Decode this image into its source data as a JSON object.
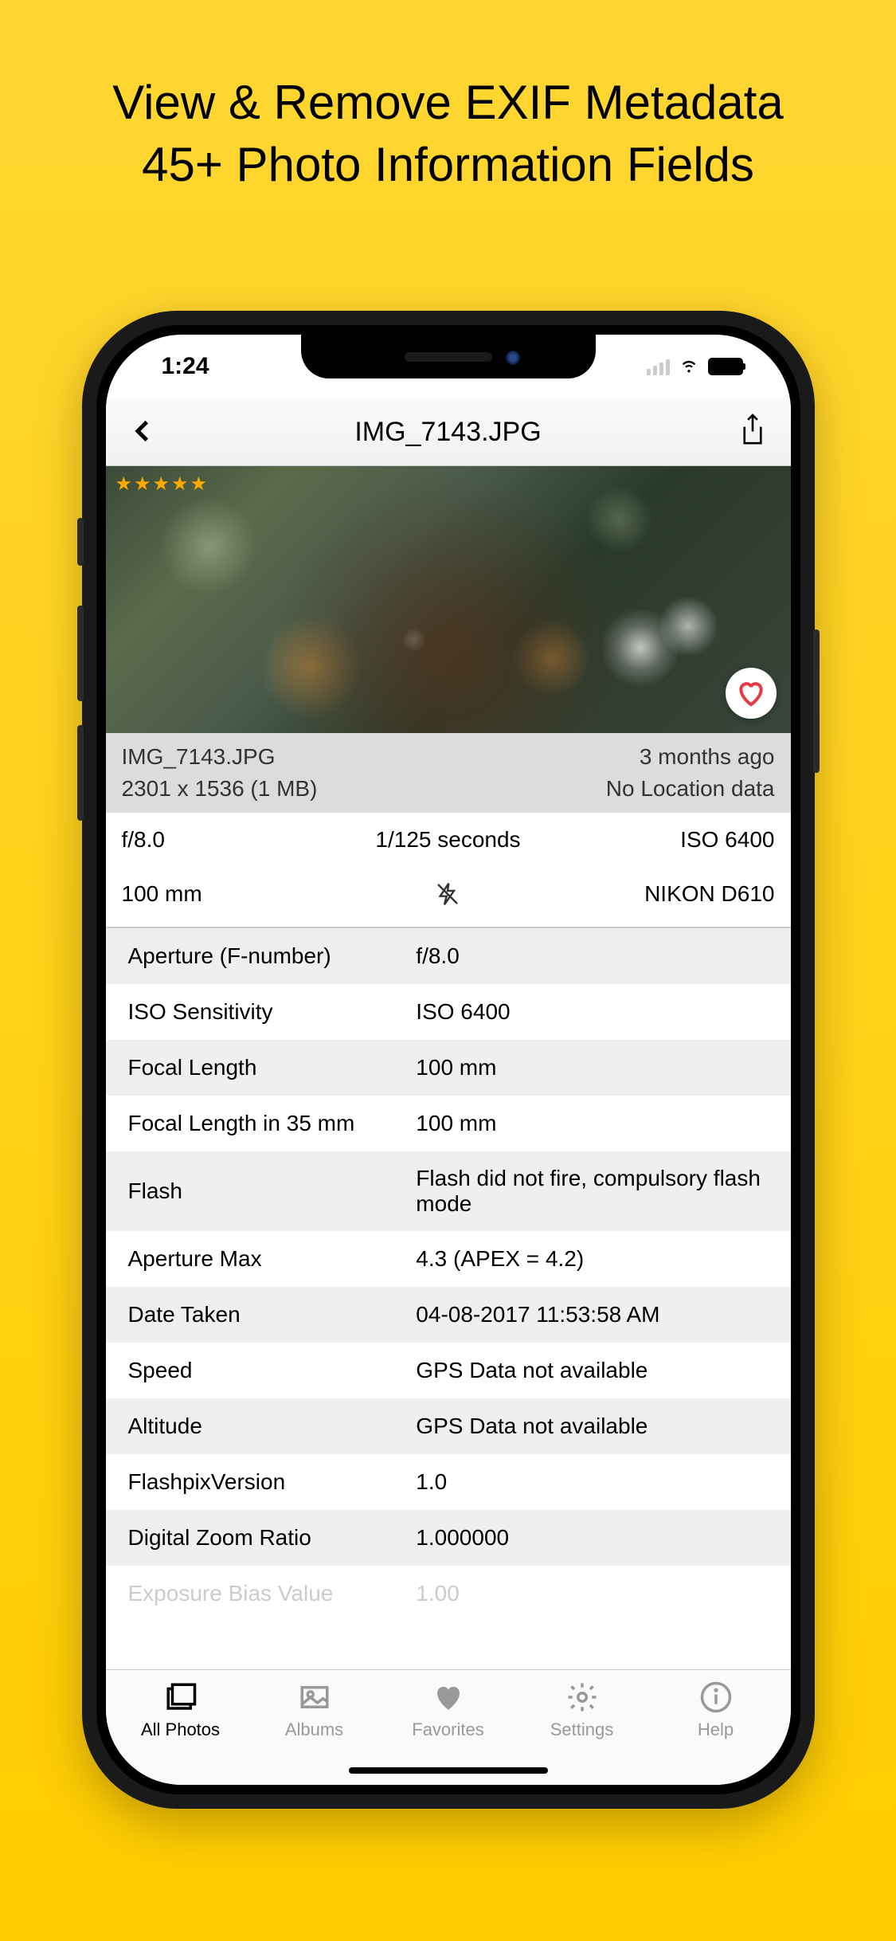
{
  "promo": {
    "line1": "View & Remove EXIF Metadata",
    "line2": "45+ Photo Information Fields"
  },
  "status": {
    "time": "1:24"
  },
  "nav": {
    "title": "IMG_7143.JPG"
  },
  "rating": {
    "stars": "★★★★★"
  },
  "summary": {
    "filename": "IMG_7143.JPG",
    "age": "3 months ago",
    "dimensions": "2301 x 1536 (1 MB)",
    "location": "No Location data"
  },
  "quick": {
    "aperture": "f/8.0",
    "shutter": "1/125 seconds",
    "iso": "ISO 6400",
    "focal": "100 mm",
    "camera": "NIKON D610"
  },
  "exif": [
    {
      "label": "Aperture (F-number)",
      "value": "f/8.0"
    },
    {
      "label": "ISO Sensitivity",
      "value": "ISO 6400"
    },
    {
      "label": "Focal Length",
      "value": "100 mm"
    },
    {
      "label": "Focal Length in 35 mm",
      "value": "100 mm"
    },
    {
      "label": "Flash",
      "value": "Flash did not fire, compulsory flash mode"
    },
    {
      "label": "Aperture Max",
      "value": "4.3 (APEX = 4.2)"
    },
    {
      "label": "Date Taken",
      "value": "04-08-2017 11:53:58 AM"
    },
    {
      "label": "Speed",
      "value": "GPS Data not available"
    },
    {
      "label": "Altitude",
      "value": "GPS Data not available"
    },
    {
      "label": "FlashpixVersion",
      "value": "1.0"
    },
    {
      "label": "Digital Zoom Ratio",
      "value": "1.000000"
    },
    {
      "label": "Exposure Bias Value",
      "value": "1.00"
    }
  ],
  "tabs": [
    {
      "label": "All Photos",
      "icon": "photos",
      "active": true
    },
    {
      "label": "Albums",
      "icon": "albums",
      "active": false
    },
    {
      "label": "Favorites",
      "icon": "heart",
      "active": false
    },
    {
      "label": "Settings",
      "icon": "gear",
      "active": false
    },
    {
      "label": "Help",
      "icon": "info",
      "active": false
    }
  ]
}
